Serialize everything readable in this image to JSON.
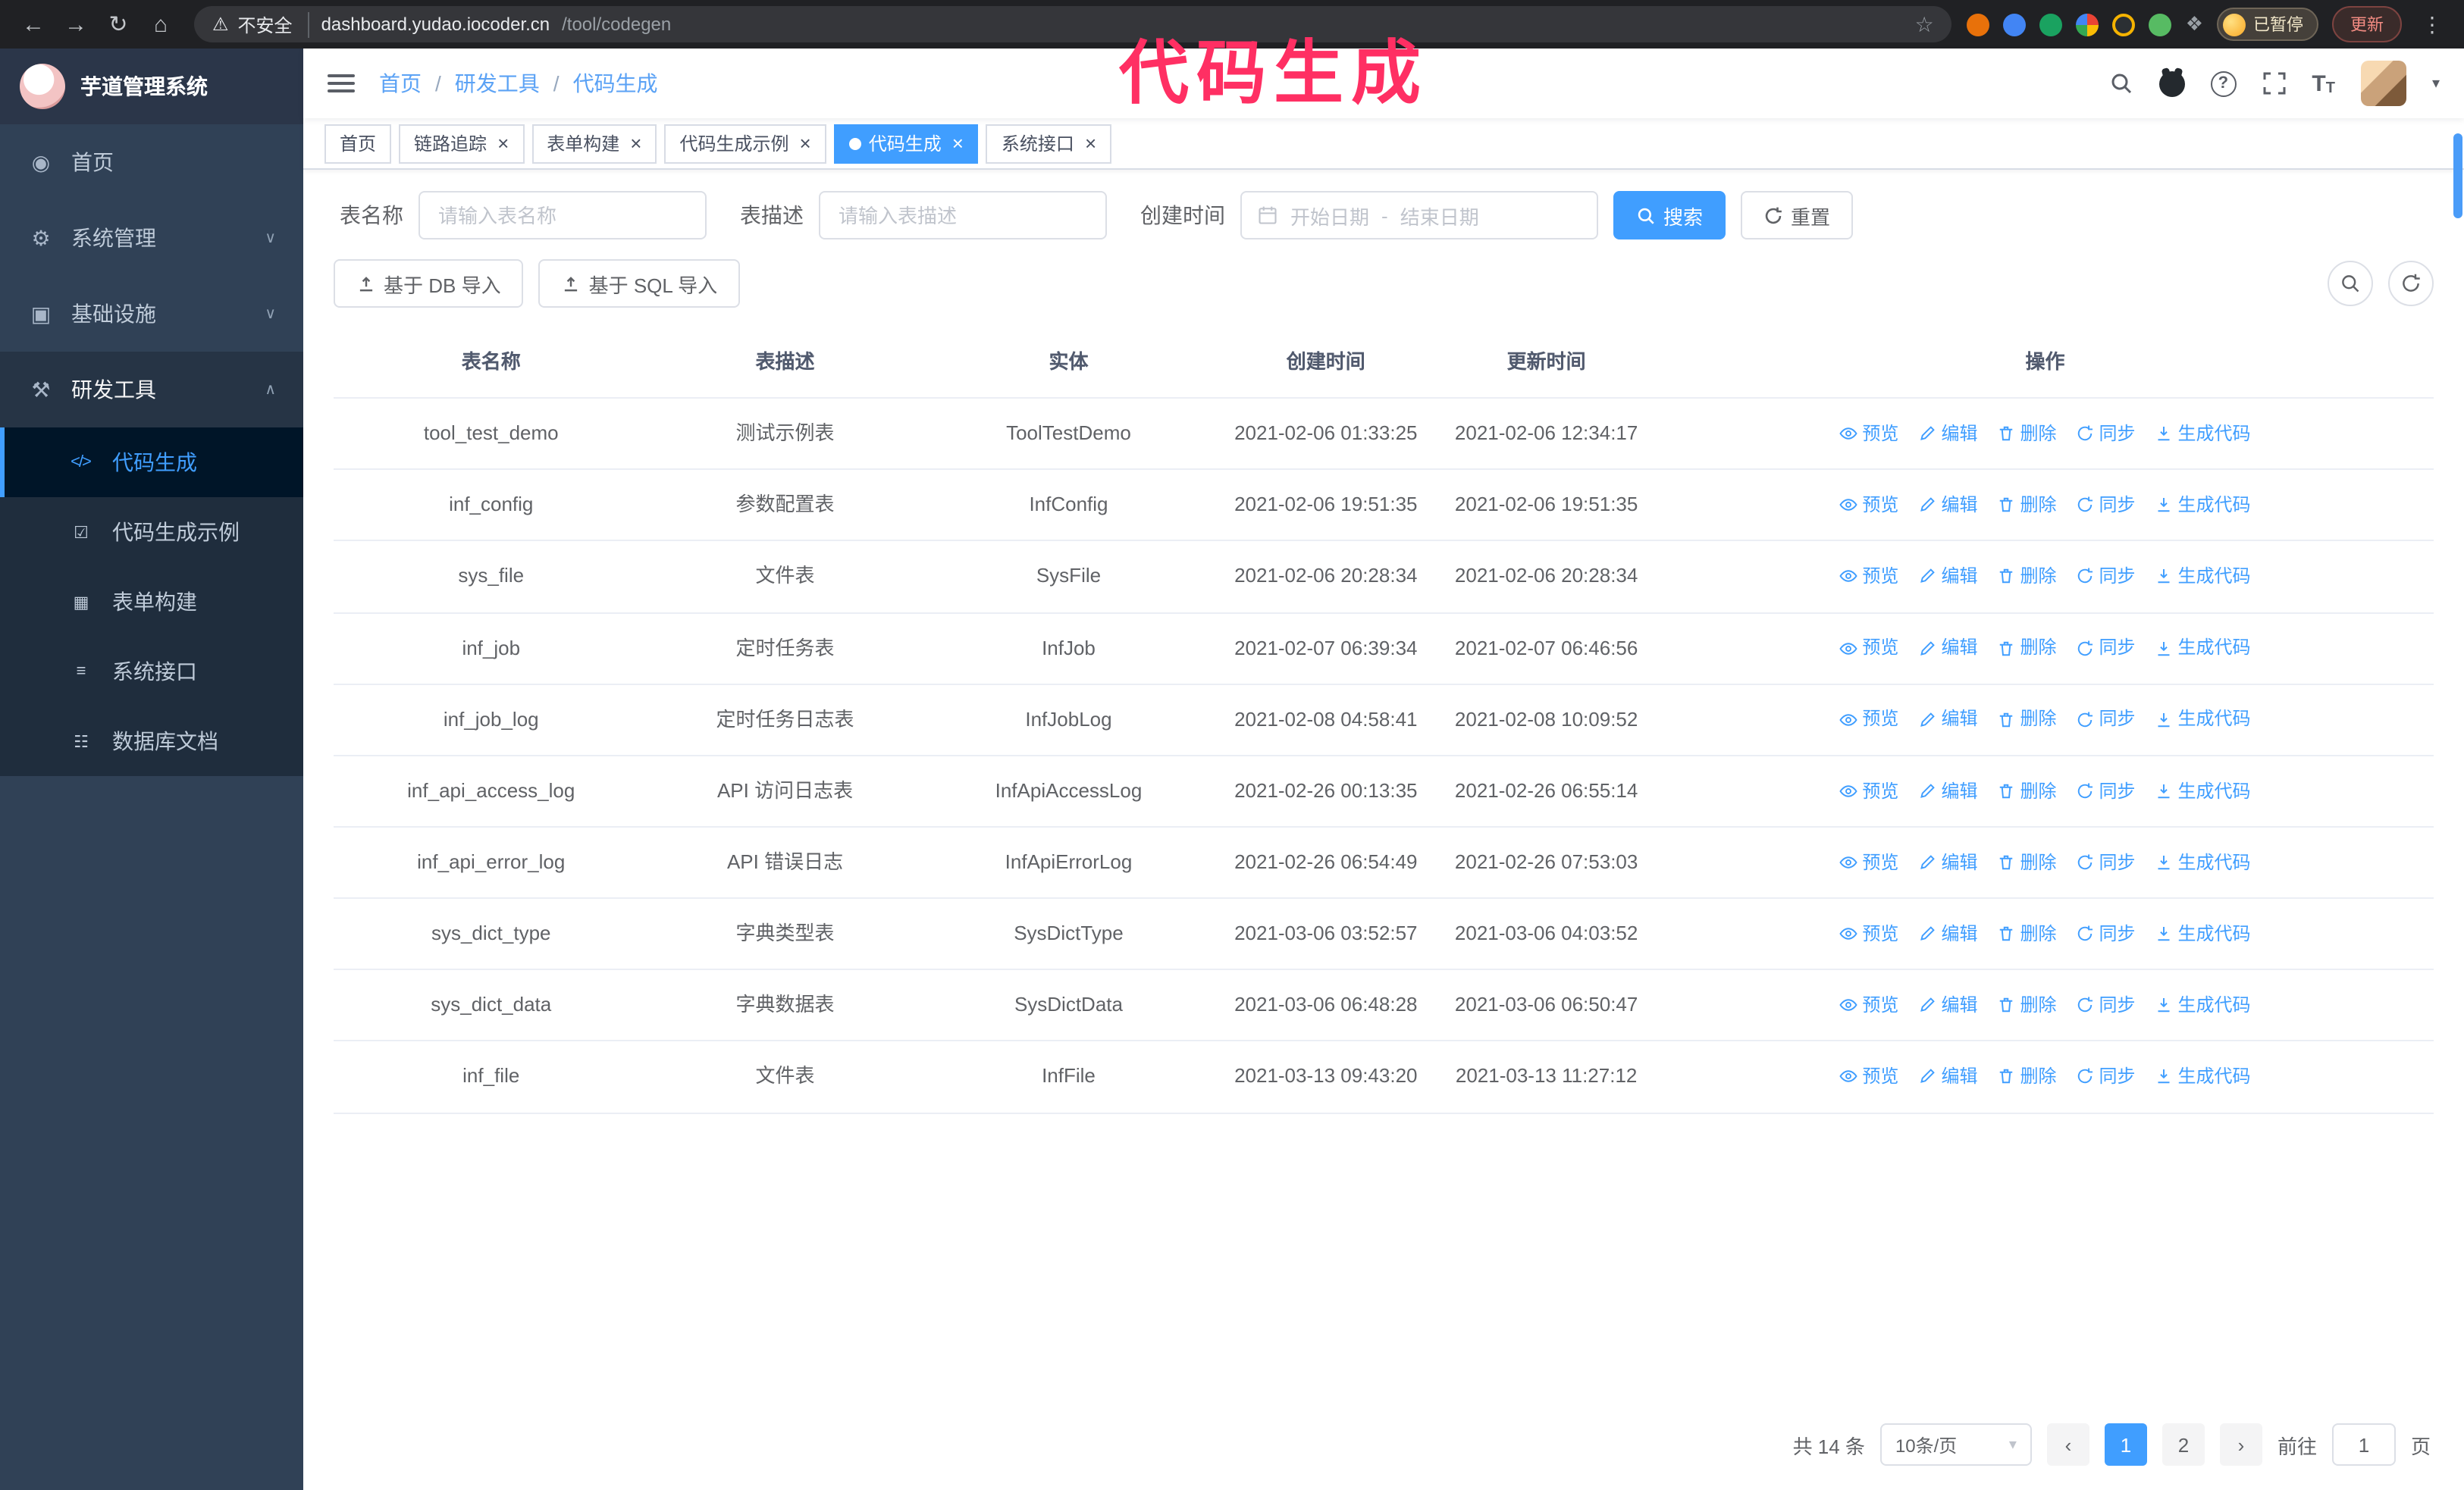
{
  "annotation": {
    "text": "代码生成",
    "color": "#ff2f63"
  },
  "browser": {
    "security_label": "不安全",
    "url_host": "dashboard.yudao.iocoder.cn",
    "url_path": "/tool/codegen",
    "profile_badge": "已暂停",
    "update_button": "更新"
  },
  "icons": {
    "back": "←",
    "forward": "→",
    "reload": "↻",
    "home": "⌂",
    "warning": "⚠",
    "star": "☆",
    "kebab": "⋮",
    "puzzle": "❖",
    "menu_home": "◉",
    "menu_system": "⚙",
    "menu_infra": "▣",
    "menu_dev": "⚒",
    "sub_codegen": "</>",
    "sub_demo": "☑",
    "sub_form": "▦",
    "sub_api": "≡",
    "sub_db": "☷",
    "chevron_down": "∨",
    "chevron_up": "∧",
    "caret_down": "▾",
    "question": "?",
    "font_size": "T",
    "close": "×",
    "prev": "‹",
    "next": "›"
  },
  "sidebar": {
    "logo_title": "芋道管理系统",
    "items": [
      {
        "label": "首页"
      },
      {
        "label": "系统管理"
      },
      {
        "label": "基础设施"
      },
      {
        "label": "研发工具"
      }
    ],
    "subitems": [
      {
        "label": "代码生成"
      },
      {
        "label": "代码生成示例"
      },
      {
        "label": "表单构建"
      },
      {
        "label": "系统接口"
      },
      {
        "label": "数据库文档"
      }
    ]
  },
  "breadcrumb": [
    "首页",
    "研发工具",
    "代码生成"
  ],
  "tabs": [
    {
      "label": "首页",
      "closable": false,
      "active": false
    },
    {
      "label": "链路追踪",
      "closable": true,
      "active": false
    },
    {
      "label": "表单构建",
      "closable": true,
      "active": false
    },
    {
      "label": "代码生成示例",
      "closable": true,
      "active": false
    },
    {
      "label": "代码生成",
      "closable": true,
      "active": true
    },
    {
      "label": "系统接口",
      "closable": true,
      "active": false
    }
  ],
  "filters": {
    "table_name_label": "表名称",
    "table_name_placeholder": "请输入表名称",
    "table_desc_label": "表描述",
    "table_desc_placeholder": "请输入表描述",
    "create_time_label": "创建时间",
    "date_start_placeholder": "开始日期",
    "date_range_separator": "-",
    "date_end_placeholder": "结束日期",
    "search_label": "搜索",
    "reset_label": "重置"
  },
  "toolbar": {
    "import_db_label": "基于 DB 导入",
    "import_sql_label": "基于 SQL 导入"
  },
  "table": {
    "columns": [
      "表名称",
      "表描述",
      "实体",
      "创建时间",
      "更新时间",
      "操作"
    ],
    "actions": [
      "预览",
      "编辑",
      "删除",
      "同步",
      "生成代码"
    ],
    "rows": [
      {
        "name": "tool_test_demo",
        "desc": "测试示例表",
        "entity": "ToolTestDemo",
        "created": "2021-02-06 01:33:25",
        "updated": "2021-02-06 12:34:17"
      },
      {
        "name": "inf_config",
        "desc": "参数配置表",
        "entity": "InfConfig",
        "created": "2021-02-06 19:51:35",
        "updated": "2021-02-06 19:51:35"
      },
      {
        "name": "sys_file",
        "desc": "文件表",
        "entity": "SysFile",
        "created": "2021-02-06 20:28:34",
        "updated": "2021-02-06 20:28:34"
      },
      {
        "name": "inf_job",
        "desc": "定时任务表",
        "entity": "InfJob",
        "created": "2021-02-07 06:39:34",
        "updated": "2021-02-07 06:46:56"
      },
      {
        "name": "inf_job_log",
        "desc": "定时任务日志表",
        "entity": "InfJobLog",
        "created": "2021-02-08 04:58:41",
        "updated": "2021-02-08 10:09:52"
      },
      {
        "name": "inf_api_access_log",
        "desc": "API 访问日志表",
        "entity": "InfApiAccessLog",
        "created": "2021-02-26 00:13:35",
        "updated": "2021-02-26 06:55:14"
      },
      {
        "name": "inf_api_error_log",
        "desc": "API 错误日志",
        "entity": "InfApiErrorLog",
        "created": "2021-02-26 06:54:49",
        "updated": "2021-02-26 07:53:03"
      },
      {
        "name": "sys_dict_type",
        "desc": "字典类型表",
        "entity": "SysDictType",
        "created": "2021-03-06 03:52:57",
        "updated": "2021-03-06 04:03:52"
      },
      {
        "name": "sys_dict_data",
        "desc": "字典数据表",
        "entity": "SysDictData",
        "created": "2021-03-06 06:48:28",
        "updated": "2021-03-06 06:50:47"
      },
      {
        "name": "inf_file",
        "desc": "文件表",
        "entity": "InfFile",
        "created": "2021-03-13 09:43:20",
        "updated": "2021-03-13 11:27:12"
      }
    ]
  },
  "pagination": {
    "total": "共 14 条",
    "page_size": "10条/页",
    "pages": [
      "1",
      "2"
    ],
    "goto_label": "前往",
    "goto_value": "1",
    "goto_unit": "页"
  }
}
